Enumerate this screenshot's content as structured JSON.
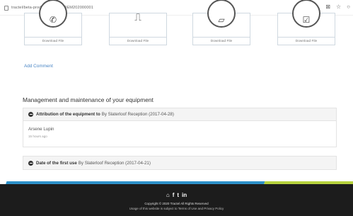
{
  "browser": {
    "url": "tractel/beta-product/003002_DEM202000001",
    "icons": [
      "lock-icon",
      "translate-icon",
      "star-icon",
      "profile-icon"
    ]
  },
  "documents": [
    {
      "label": "Download File",
      "icon": "phone-icon"
    },
    {
      "label": "Download File",
      "icon": "book-icon"
    },
    {
      "label": "Download File",
      "icon": "document-icon"
    },
    {
      "label": "Download File",
      "icon": "checklist-icon"
    }
  ],
  "add_comment": "Add Comment",
  "section": {
    "title": "Management and maintenance of your equipment",
    "items": [
      {
        "title": "Attribution of the equipment to",
        "by": "By Slaterloof Reception (2017-04-28)",
        "person": "Arsene Lupin",
        "time": "15 hours ago"
      },
      {
        "title": "Date of the first use",
        "by": "By Slaterloof Reception (2017-04-21)"
      }
    ]
  },
  "footer": {
    "copyright": "Copyright © 2020 Tractel All Rights Reserved",
    "terms": "Usage of this website is subject to Terms of Use and Privacy Policy",
    "social_icons": [
      "home-icon",
      "facebook-icon",
      "twitter-icon",
      "linkedin-icon"
    ],
    "accent_blue": "#2d91c9",
    "accent_green": "#b6d23d"
  }
}
